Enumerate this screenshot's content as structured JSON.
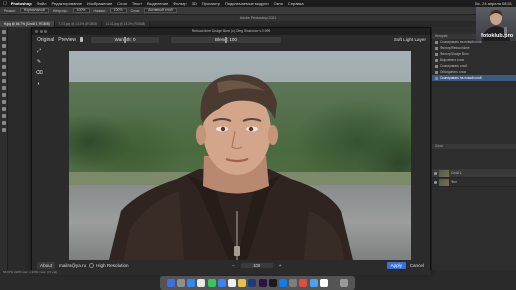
{
  "mac_menubar": {
    "apple": "",
    "app_name": "Photoshop",
    "items": [
      "Файл",
      "Редактирование",
      "Изображение",
      "Слои",
      "Текст",
      "Выделение",
      "Фильтр",
      "3D",
      "Просмотр",
      "Подключаемые модули",
      "Окно",
      "Справка"
    ],
    "clock": "Вс, 24 апреля 08:31"
  },
  "options_bar": {
    "items": [
      "Режим:",
      "Нормальный",
      "Непрозр.:",
      "100%",
      "Нажим:",
      "100%",
      "Слои:",
      "Активный слой"
    ]
  },
  "ps_window_title": "Adobe Photoshop 2021",
  "doc_tabs": [
    {
      "label": "ff.jpg @ 66,7% (Слой 1, RGB/8)",
      "active": true
    },
    {
      "label": "T-03.jpg @ 13,3% (RGB/8)",
      "active": false
    },
    {
      "label": "11-11.jpg @ 13,3% (RGB/8)",
      "active": false
    }
  ],
  "plugin": {
    "title": "Retouch4me Dodge Burn (c) Oleg Sharonov v.0.999",
    "original_label": "Original",
    "preview_label": "Preview",
    "warmth_label": "Warmth: 0",
    "blend_label": "Blend: 100",
    "soft_light_label": "Soft Light Layer",
    "about_label": "About",
    "email": "mailrs@ya.ru",
    "high_res_label": "High Resolution",
    "zoom_minus": "−",
    "zoom_value": "100",
    "zoom_plus": "+",
    "apply_label": "Apply",
    "cancel_label": "Cancel"
  },
  "right_panel": {
    "history_header": "История",
    "history_items": [
      {
        "label": "Скопировать на новый слой",
        "selected": false
      },
      {
        "label": "Фильтр/Retouch4me",
        "selected": false
      },
      {
        "label": "Фильтр/Dodge Burn",
        "selected": false
      },
      {
        "label": "Выровнять слои",
        "selected": false
      },
      {
        "label": "Скопировать слой",
        "selected": false
      },
      {
        "label": "Объединить слои",
        "selected": false
      },
      {
        "label": "Скопировать на новый слой",
        "selected": true
      }
    ],
    "layers_header": "Слои",
    "layers": [
      {
        "label": "Слой 1",
        "selected": true
      },
      {
        "label": "Фон",
        "selected": false
      }
    ]
  },
  "streamer_brand": "fotoklub.pro",
  "status_bar": "66,67%   2268 пикс. x 2250 пикс. (72 ppi)",
  "colors": {
    "apply_button": "#3a6fd8",
    "history_selected": "#3d5a80"
  }
}
